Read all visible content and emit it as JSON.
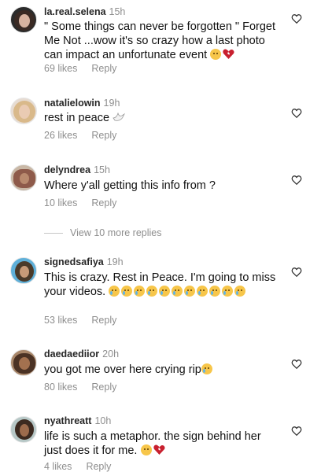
{
  "comments": [
    {
      "username": "la.real.selena",
      "time": "15h",
      "text": "\" Some things can never be forgotten \" Forget Me Not ...wow it's so crazy how a last photo can impact an unfortunate event",
      "emojis": [
        "sad-face",
        "broken-heart"
      ],
      "likes": "69 likes",
      "reply": "Reply"
    },
    {
      "username": "natalielowin",
      "time": "19h",
      "text": "rest in peace",
      "emojis": [
        "dove"
      ],
      "likes": "26 likes",
      "reply": "Reply"
    },
    {
      "username": "delyndrea",
      "time": "15h",
      "text": "Where y'all getting this info from ?",
      "emojis": [],
      "likes": "10 likes",
      "reply": "Reply"
    },
    {
      "username": "signedsafiya",
      "time": "19h",
      "text": "This is crazy. Rest in Peace. I'm going to miss your videos.",
      "emojis": [
        "crying-face",
        "crying-face",
        "crying-face",
        "crying-face",
        "crying-face",
        "crying-face",
        "crying-face",
        "crying-face",
        "crying-face",
        "crying-face",
        "crying-face"
      ],
      "likes": "53 likes",
      "reply": "Reply"
    },
    {
      "username": "daedaediior",
      "time": "20h",
      "text": "you got me over here crying rip",
      "emojis": [
        "crying-face"
      ],
      "likes": "80 likes",
      "reply": "Reply"
    },
    {
      "username": "nyathreatt",
      "time": "10h",
      "text": "life is such a metaphor. the sign behind her just does it for me.",
      "emojis": [
        "pleading-face",
        "broken-heart"
      ],
      "likes": "4 likes",
      "reply": "Reply"
    }
  ],
  "view_more": "View 10 more replies",
  "colors": {
    "text": "#111111",
    "muted": "#8e8e8e",
    "username": "#262626",
    "heart_stroke": "#262626"
  }
}
